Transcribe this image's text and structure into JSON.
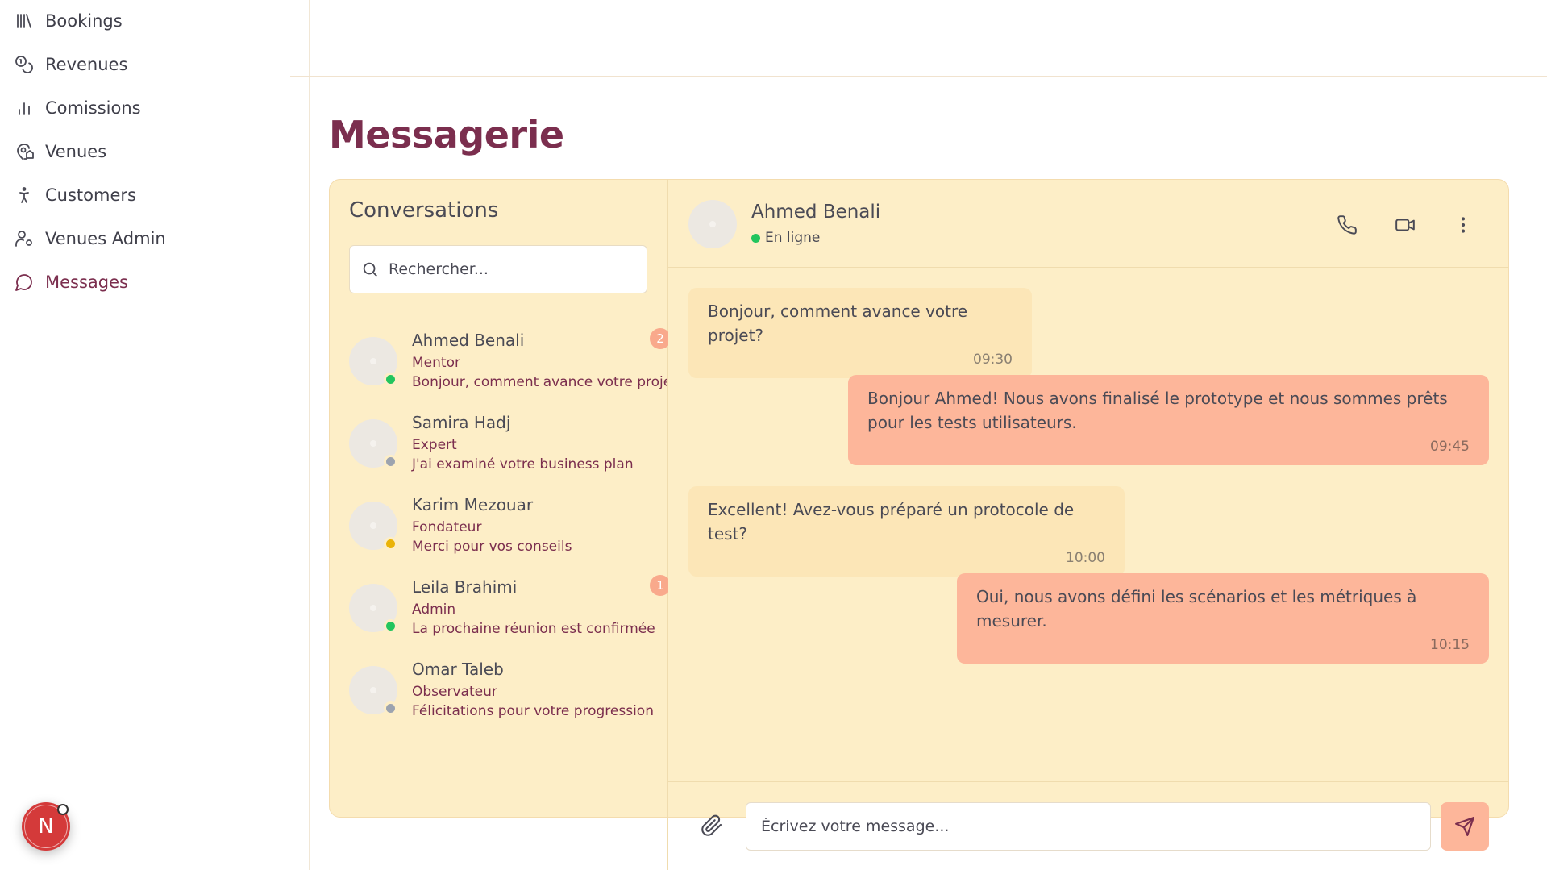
{
  "sidebar": {
    "items": [
      {
        "label": "Bookings",
        "icon": "library-icon"
      },
      {
        "label": "Revenues",
        "icon": "coins-icon"
      },
      {
        "label": "Comissions",
        "icon": "bar-chart-icon"
      },
      {
        "label": "Venues",
        "icon": "map-pin-house-icon"
      },
      {
        "label": "Customers",
        "icon": "person-standing-icon"
      },
      {
        "label": "Venues Admin",
        "icon": "user-cog-icon"
      },
      {
        "label": "Messages",
        "icon": "message-circle-icon",
        "active": true
      }
    ],
    "user_initial": "N"
  },
  "page": {
    "title": "Messagerie"
  },
  "conversations": {
    "title": "Conversations",
    "search_placeholder": "Rechercher...",
    "items": [
      {
        "name": "Ahmed Benali",
        "role": "Mentor",
        "preview": "Bonjour, comment avance votre projet?",
        "status": "online",
        "unread": "2"
      },
      {
        "name": "Samira Hadj",
        "role": "Expert",
        "preview": "J'ai examiné votre business plan",
        "status": "offline",
        "unread": ""
      },
      {
        "name": "Karim Mezouar",
        "role": "Fondateur",
        "preview": "Merci pour vos conseils",
        "status": "away",
        "unread": ""
      },
      {
        "name": "Leila Brahimi",
        "role": "Admin",
        "preview": "La prochaine réunion est confirmée",
        "status": "online",
        "unread": "1"
      },
      {
        "name": "Omar Taleb",
        "role": "Observateur",
        "preview": "Félicitations pour votre progression",
        "status": "offline",
        "unread": ""
      }
    ]
  },
  "chat": {
    "contact_name": "Ahmed Benali",
    "contact_status": "En ligne",
    "messages": [
      {
        "direction": "in",
        "text": "Bonjour, comment avance votre projet?",
        "time": "09:30"
      },
      {
        "direction": "out",
        "text": "Bonjour Ahmed! Nous avons finalisé le prototype et nous sommes prêts pour les tests utilisateurs.",
        "time": "09:45"
      },
      {
        "direction": "in",
        "text": "Excellent! Avez-vous préparé un protocole de test?",
        "time": "10:00"
      },
      {
        "direction": "out",
        "text": "Oui, nous avons défini les scénarios et les métriques à mesurer.",
        "time": "10:15"
      }
    ],
    "input_placeholder": "Écrivez votre message..."
  },
  "colors": {
    "brand": "#7b2e4e",
    "card_bg": "#fdeec7",
    "incoming_bubble": "#fce6b7",
    "outgoing_bubble": "#fdb69a",
    "status_online": "#22c55e",
    "status_offline": "#9ca3af",
    "status_away": "#eab308"
  }
}
